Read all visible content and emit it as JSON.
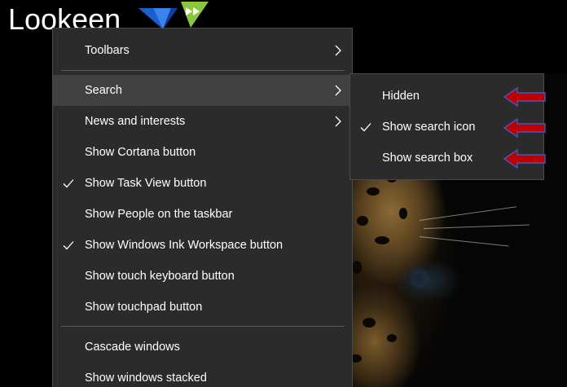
{
  "logo": {
    "text": "Lookeen"
  },
  "context_menu": {
    "items": [
      {
        "label": "Toolbars",
        "checked": false,
        "submenu": true
      },
      {
        "label": "Search",
        "checked": false,
        "submenu": true,
        "highlighted": true
      },
      {
        "label": "News and interests",
        "checked": false,
        "submenu": true
      },
      {
        "label": "Show Cortana button",
        "checked": false,
        "submenu": false
      },
      {
        "label": "Show Task View button",
        "checked": true,
        "submenu": false
      },
      {
        "label": "Show People on the taskbar",
        "checked": false,
        "submenu": false
      },
      {
        "label": "Show Windows Ink Workspace button",
        "checked": true,
        "submenu": false
      },
      {
        "label": "Show touch keyboard button",
        "checked": false,
        "submenu": false
      },
      {
        "label": "Show touchpad button",
        "checked": false,
        "submenu": false
      },
      {
        "label": "Cascade windows",
        "checked": false,
        "submenu": false
      },
      {
        "label": "Show windows stacked",
        "checked": false,
        "submenu": false
      }
    ]
  },
  "search_submenu": {
    "items": [
      {
        "label": "Hidden",
        "checked": false
      },
      {
        "label": "Show search icon",
        "checked": true
      },
      {
        "label": "Show search box",
        "checked": false
      }
    ]
  },
  "colors": {
    "menu_bg": "#2b2b2b",
    "menu_hover": "#414141",
    "menu_text": "#ffffff",
    "arrow_red": "#c00000",
    "arrow_outline": "#3b5bbf",
    "logo_blue": "#1a5fd0",
    "logo_green": "#8cc63f"
  },
  "icons": {
    "check": "check-icon",
    "submenu": "chevron-right-icon",
    "annotation": "red-arrow-icon"
  }
}
